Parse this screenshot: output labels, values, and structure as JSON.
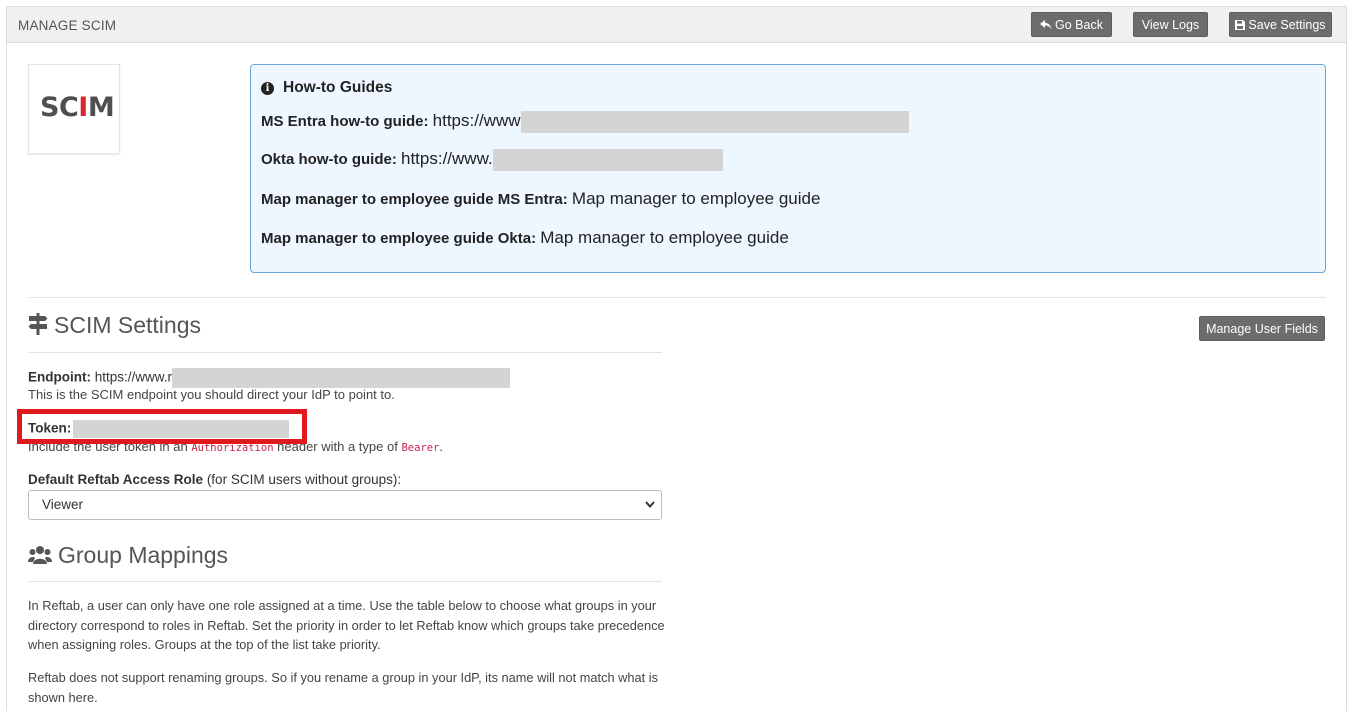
{
  "header": {
    "title": "MANAGE SCIM",
    "go_back_label": "Go Back",
    "view_logs_label": "View Logs",
    "save_settings_label": "Save Settings"
  },
  "logo": {
    "text_left": "SC",
    "text_mid": "I",
    "text_right": "M"
  },
  "guides": {
    "title": "How-to Guides",
    "items": [
      {
        "label": "MS Entra how-to guide:",
        "value": "https://www"
      },
      {
        "label": "Okta how-to guide:",
        "value": "https://www."
      },
      {
        "label": "Map manager to employee guide MS Entra:",
        "value": "Map manager to employee guide"
      },
      {
        "label": "Map manager to employee guide Okta:",
        "value": "Map manager to employee guide"
      }
    ]
  },
  "scim_settings": {
    "title": "SCIM Settings",
    "manage_user_fields_label": "Manage User Fields",
    "endpoint_label": "Endpoint:",
    "endpoint_value": "https://www.r",
    "endpoint_help": "This is the SCIM endpoint you should direct your IdP to point to.",
    "token_label": "Token:",
    "token_help_pre": "Include the user token in an ",
    "token_help_code1": "Authorization",
    "token_help_mid": " header with a type of ",
    "token_help_code2": "Bearer",
    "token_help_post": ".",
    "role_label": "Default Reftab Access Role",
    "role_label_suffix": " (for SCIM users without groups):",
    "role_selected": "Viewer"
  },
  "group_mappings": {
    "title": "Group Mappings",
    "paragraph1": "In Reftab, a user can only have one role assigned at a time. Use the table below to choose what groups in your directory correspond to roles in Reftab. Set the priority in order to let Reftab know which groups take precedence when assigning roles. Groups at the top of the list take priority.",
    "paragraph2": "Reftab does not support renaming groups. So if you rename a group in your IdP, its name will not match what is shown here."
  },
  "colors": {
    "button_bg": "#6c6c6c",
    "guides_bg": "#eef6ff",
    "guides_border": "#6ba6d9",
    "highlight": "#e0191f",
    "code": "#c7254e"
  },
  "icons": {
    "go_back": "reply-arrow-icon",
    "save": "floppy-disk-icon",
    "info": "info-circle-icon",
    "settings": "signpost-icon",
    "groups": "users-icon",
    "select_caret": "chevron-down-icon"
  }
}
